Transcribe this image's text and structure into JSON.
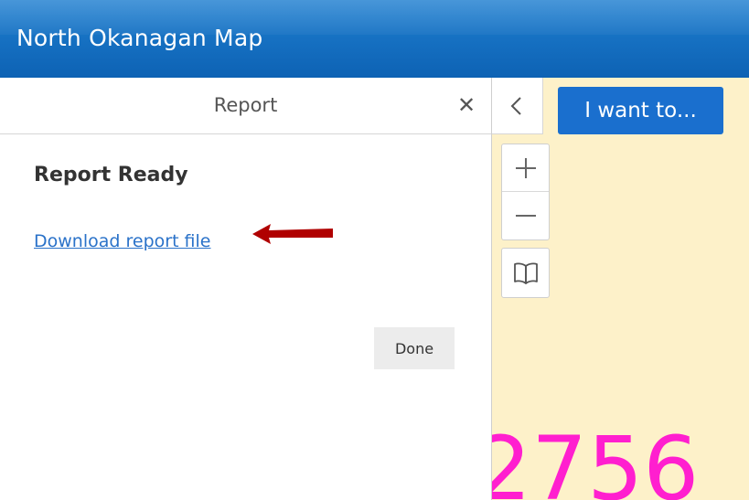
{
  "app": {
    "title": "North Okanagan Map"
  },
  "panel": {
    "title": "Report",
    "close_icon": "close-icon",
    "close_glyph": "✕",
    "heading": "Report Ready",
    "download_link": "Download report file",
    "done_label": "Done"
  },
  "map": {
    "iwant_label": "I want to...",
    "label_text": "2756",
    "collapse_icon": "chevron-left-icon",
    "zoom_in_icon": "plus-icon",
    "zoom_out_icon": "minus-icon",
    "bookmark_icon": "book-icon"
  },
  "colors": {
    "header_blue": "#0d62b4",
    "button_blue": "#1a6fce",
    "link_blue": "#2a72c9",
    "map_background": "#fdf1c9",
    "map_label": "#ff1fcf",
    "arrow_red": "#b00000"
  }
}
